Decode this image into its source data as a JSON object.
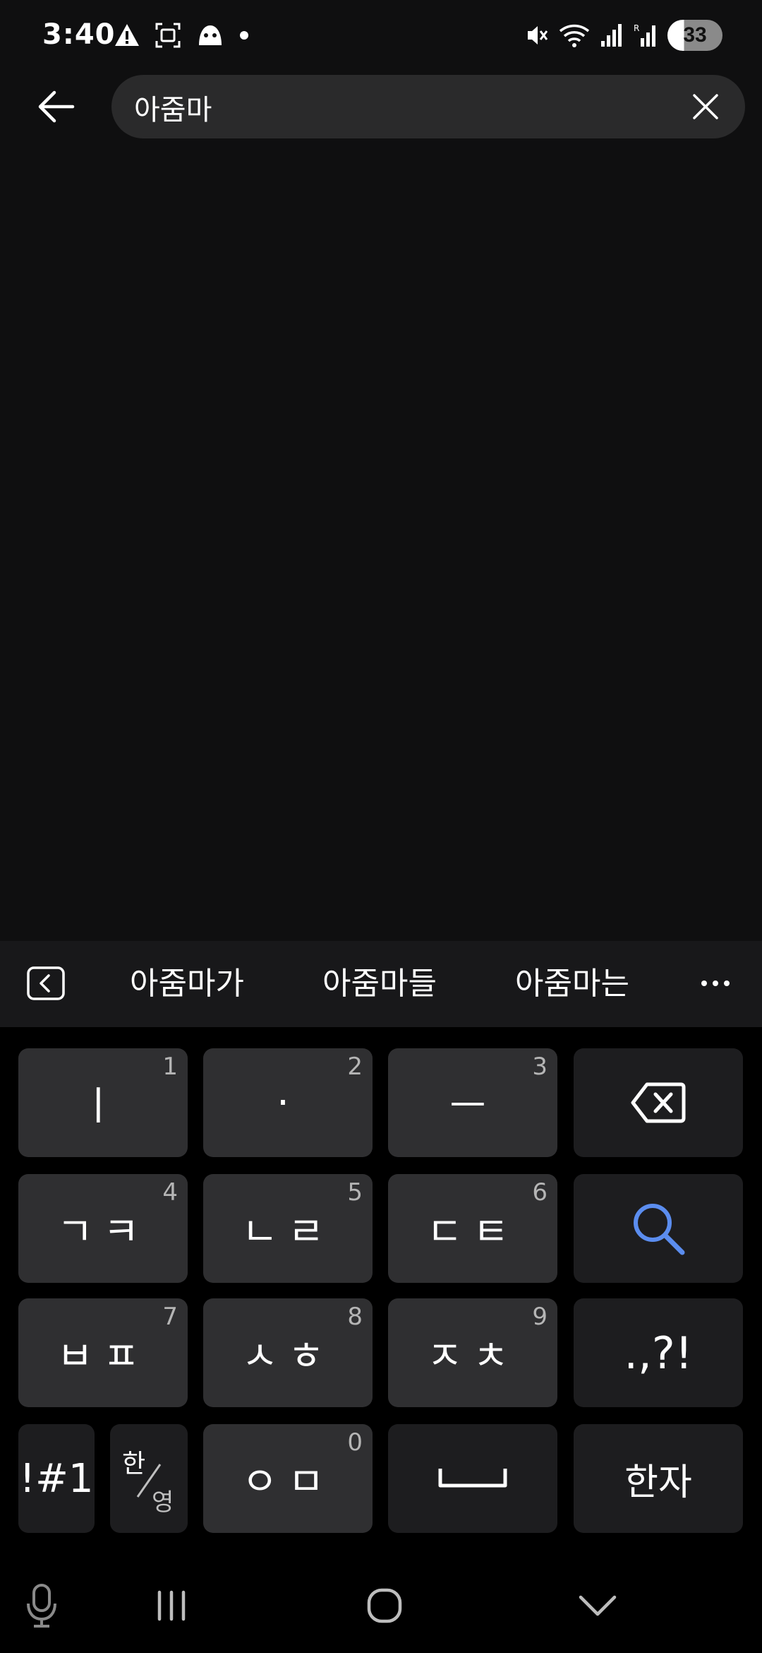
{
  "status_bar": {
    "time": "3:40",
    "battery_level": "33",
    "left_icons": [
      "warning-icon",
      "screenshot-icon",
      "game-icon",
      "dot-icon"
    ],
    "right_icons": [
      "mute-icon",
      "wifi-icon",
      "signal-icon",
      "signal-roaming-icon",
      "battery-icon"
    ]
  },
  "search": {
    "query": "아줌마",
    "back_icon": "arrow-left-icon",
    "clear_icon": "close-icon"
  },
  "suggestions": {
    "items": [
      "아줌마가",
      "아줌마들",
      "아줌마는"
    ],
    "collapse_icon": "collapse-left-icon",
    "more_icon": "more-horizontal-icon"
  },
  "keyboard": {
    "rows": [
      [
        {
          "label": "ㅣ",
          "num": "1"
        },
        {
          "label": "·",
          "num": "2"
        },
        {
          "label": "ㅡ",
          "num": "3"
        },
        {
          "label": "",
          "icon": "backspace-icon"
        }
      ],
      [
        {
          "label": "ㄱㅋ",
          "num": "4"
        },
        {
          "label": "ㄴㄹ",
          "num": "5"
        },
        {
          "label": "ㄷㅌ",
          "num": "6"
        },
        {
          "label": "",
          "icon": "search-icon"
        }
      ],
      [
        {
          "label": "ㅂㅍ",
          "num": "7"
        },
        {
          "label": "ㅅㅎ",
          "num": "8"
        },
        {
          "label": "ㅈㅊ",
          "num": "9"
        },
        {
          "label": ".,?!"
        }
      ],
      [
        {
          "label": "!#1"
        },
        {
          "label_top": "한",
          "label_bottom": "영"
        },
        {
          "label": "ㅇㅁ",
          "num": "0"
        },
        {
          "label": "",
          "icon": "space-icon"
        },
        {
          "label": "한자"
        }
      ]
    ],
    "accent_color": "#5b8def"
  },
  "nav_bar": {
    "icons": [
      "microphone-icon",
      "recent-apps-icon",
      "home-icon",
      "hide-keyboard-icon"
    ]
  }
}
